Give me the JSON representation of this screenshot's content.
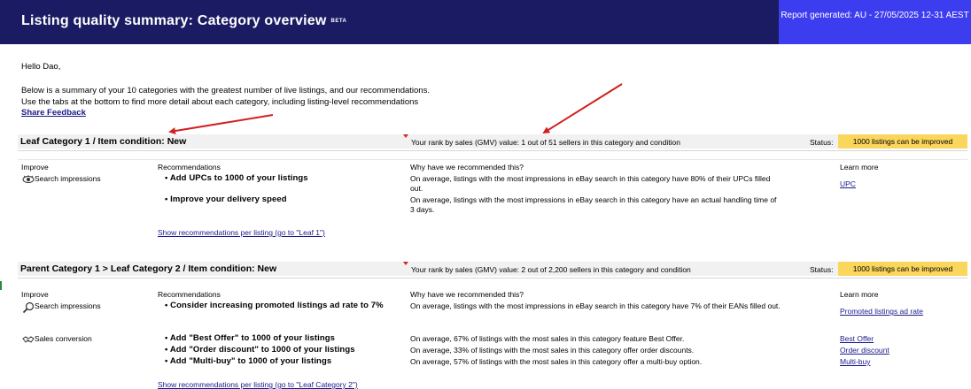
{
  "header": {
    "title": "Listing quality summary: Category overview",
    "beta": "BETA",
    "report": "Report generated: AU - 27/05/2025 12-31 AEST"
  },
  "intro": {
    "greeting": "Hello Dao,",
    "line1": "Below is a summary of your 10 categories with the greatest number of live listings, and our recommendations.",
    "line2": "Use the tabs at the bottom to find more detail about each category, including listing-level recommendations",
    "feedback": "Share Feedback"
  },
  "columns": {
    "improve": "Improve",
    "recommendations": "Recommendations",
    "why": "Why have we recommended this?",
    "learn": "Learn more"
  },
  "status_label": "Status:",
  "colors": {
    "banner": "#1b1b63",
    "report_bg": "#3d3df0",
    "badge": "#fbd65c",
    "arrow": "#d22020"
  },
  "sections": [
    {
      "title": "Leaf Category 1  /  Item condition: New",
      "rank": "Your rank by sales (GMV) value: 1 out of 51 sellers in this category and condition",
      "status": "1000 listings can be improved",
      "groups": [
        {
          "improve": "Search impressions",
          "icon": "eye-icon",
          "items": [
            {
              "rec": "• Add UPCs to 1000 of your listings",
              "why": "On average, listings with the most impressions in eBay search in this category have 80% of their UPCs filled out.",
              "learn": "UPC"
            },
            {
              "rec": "• Improve your delivery speed",
              "why": "On average, listings with the most impressions in eBay search in this category have an actual handling time of 3 days.",
              "learn": ""
            }
          ]
        }
      ],
      "show_link": "Show recommendations per listing (go to \"Leaf 1\")"
    },
    {
      "title": "Parent Category 1 > Leaf Category 2 /  Item condition: New",
      "rank": "Your rank by sales (GMV) value: 2 out of 2,200 sellers in this category and condition",
      "status": "1000 listings can be improved",
      "groups": [
        {
          "improve": "Search impressions",
          "icon": "magnifier-icon",
          "items": [
            {
              "rec": "• Consider increasing promoted listings ad rate to 7%",
              "why": "On average, listings with the most impressions in eBay search in this category have 7% of their EANs filled out.",
              "learn": "Promoted listings ad rate"
            }
          ]
        },
        {
          "improve": "Sales conversion",
          "icon": "handshake-icon",
          "items": [
            {
              "rec": "• Add \"Best Offer\" to 1000 of your listings",
              "why": "On average, 67% of listings with the most sales in this category feature Best Offer.",
              "learn": "Best Offer"
            },
            {
              "rec": "• Add \"Order discount\" to 1000 of your listings",
              "why": "On average, 33% of listings with the most sales in this category offer order discounts.",
              "learn": "Order discount"
            },
            {
              "rec": "• Add \"Multi-buy\" to 1000 of your listings",
              "why": "On average, 57% of listings with the most sales in this category offer a multi-buy option.",
              "learn": "Multi-buy"
            }
          ]
        }
      ],
      "show_link": "Show recommendations per listing (go to \"Leaf Category 2\")"
    }
  ]
}
